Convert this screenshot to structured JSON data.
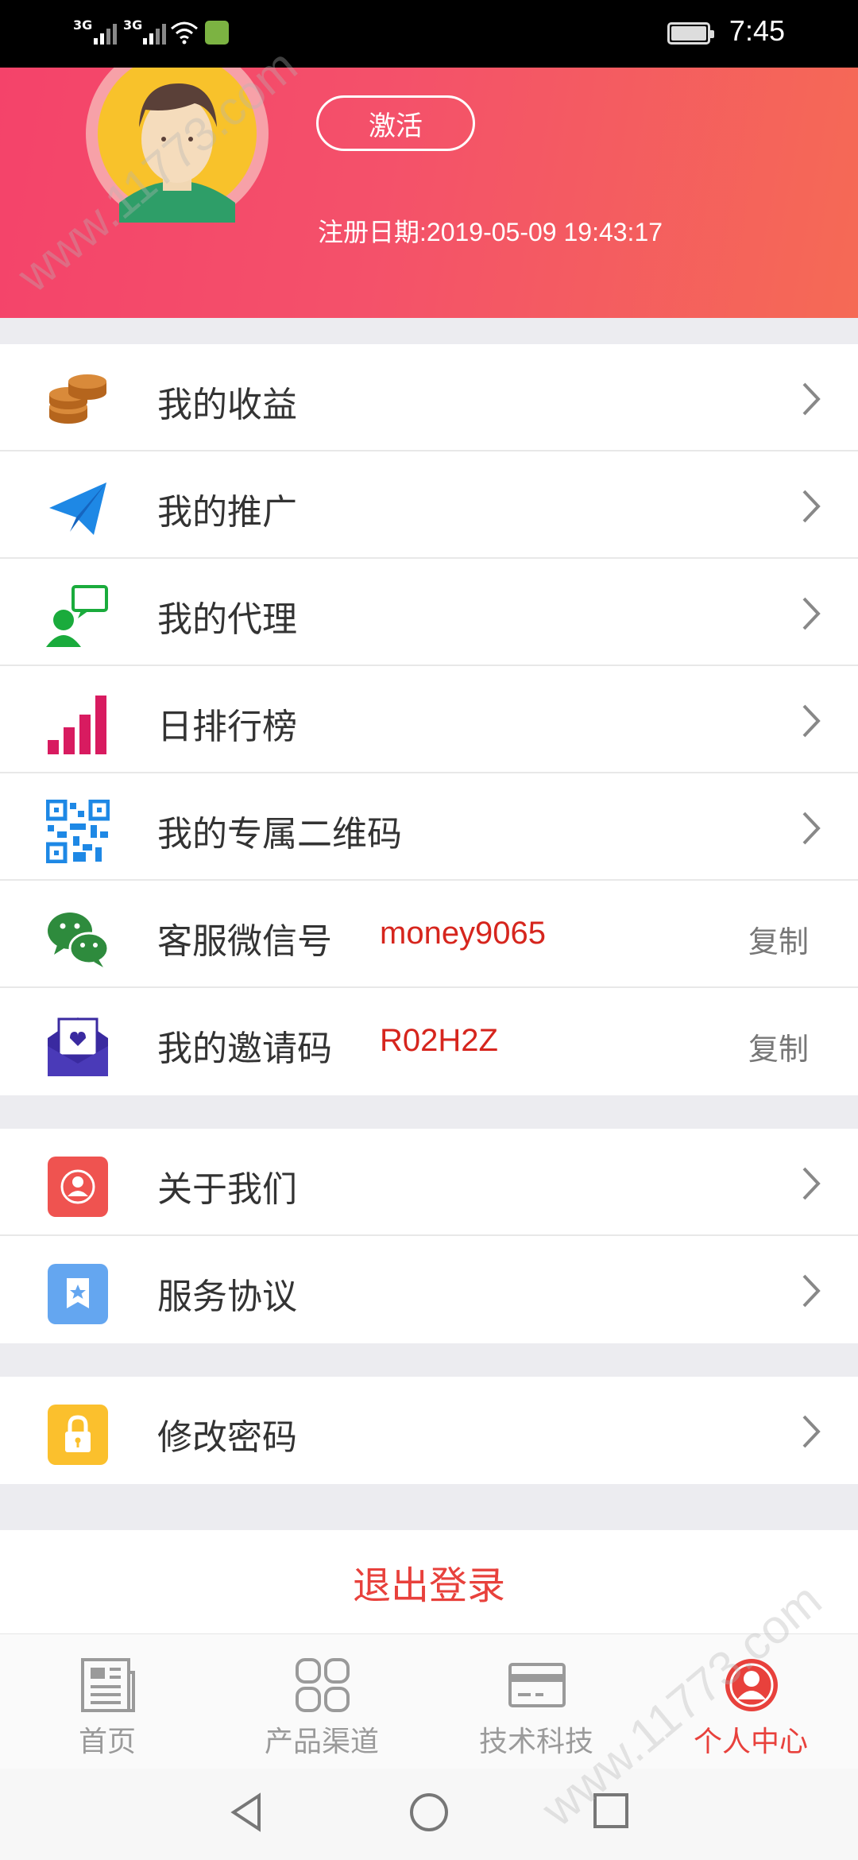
{
  "status_bar": {
    "signal_1": "3G",
    "signal_2": "3G",
    "time": "7:45"
  },
  "profile": {
    "activate_label": "激活",
    "register_date": "注册日期:2019-05-09 19:43:17"
  },
  "menu_group_1": [
    {
      "label": "我的收益",
      "icon": "coins-icon"
    },
    {
      "label": "我的推广",
      "icon": "paper-plane-icon"
    },
    {
      "label": "我的代理",
      "icon": "agent-chat-icon"
    },
    {
      "label": "日排行榜",
      "icon": "bar-chart-icon"
    },
    {
      "label": "我的专属二维码",
      "icon": "qr-code-icon"
    },
    {
      "label": "客服微信号",
      "icon": "wechat-icon",
      "value": "money9065",
      "action": "复制"
    },
    {
      "label": "我的邀请码",
      "icon": "invite-envelope-icon",
      "value": "R02H2Z",
      "action": "复制"
    }
  ],
  "menu_group_2": [
    {
      "label": "关于我们",
      "icon": "about-us-icon"
    },
    {
      "label": "服务协议",
      "icon": "service-agreement-icon"
    }
  ],
  "menu_group_3": [
    {
      "label": "修改密码",
      "icon": "lock-icon"
    }
  ],
  "logout_label": "退出登录",
  "tabs": [
    {
      "label": "首页",
      "icon": "newspaper-icon"
    },
    {
      "label": "产品渠道",
      "icon": "grid-icon"
    },
    {
      "label": "技术科技",
      "icon": "card-icon"
    },
    {
      "label": "个人中心",
      "icon": "user-circle-icon",
      "active": true
    }
  ],
  "watermark": "www.11773.com",
  "colors": {
    "accent": "#e8413c",
    "header_start": "#f4436a",
    "header_end": "#f56a55",
    "value_red": "#d6251d"
  }
}
